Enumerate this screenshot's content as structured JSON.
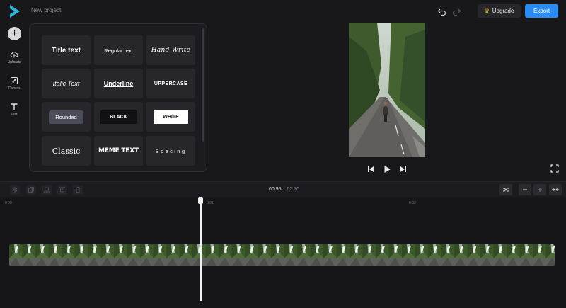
{
  "app": {
    "project_title": "New project",
    "brand_color": "#2fb5d9"
  },
  "header": {
    "upgrade_label": "Upgrade",
    "export_label": "Export",
    "export_color": "#2a8cf2"
  },
  "sidebar": {
    "items": [
      {
        "label": "Uploads",
        "icon": "upload-cloud-icon"
      },
      {
        "label": "Canvas",
        "icon": "canvas-resize-icon"
      },
      {
        "label": "Text",
        "icon": "text-t-icon"
      }
    ]
  },
  "text_presets": [
    {
      "label": "Title text"
    },
    {
      "label": "Regular text"
    },
    {
      "label": "Hand Write"
    },
    {
      "label": "Italic Text"
    },
    {
      "label": "Underline"
    },
    {
      "label": "UPPERCASE"
    },
    {
      "label": "Rounded"
    },
    {
      "label": "BLACK"
    },
    {
      "label": "WHITE"
    },
    {
      "label": "Classic"
    },
    {
      "label": "MEME TEXT"
    },
    {
      "label": "Spacing"
    }
  ],
  "timeline": {
    "current_time": "00.95",
    "separator": "/",
    "total_time": "02.70",
    "ticks": [
      "0:00",
      "0:01",
      "0:02"
    ],
    "playhead_fraction": 0.35
  }
}
